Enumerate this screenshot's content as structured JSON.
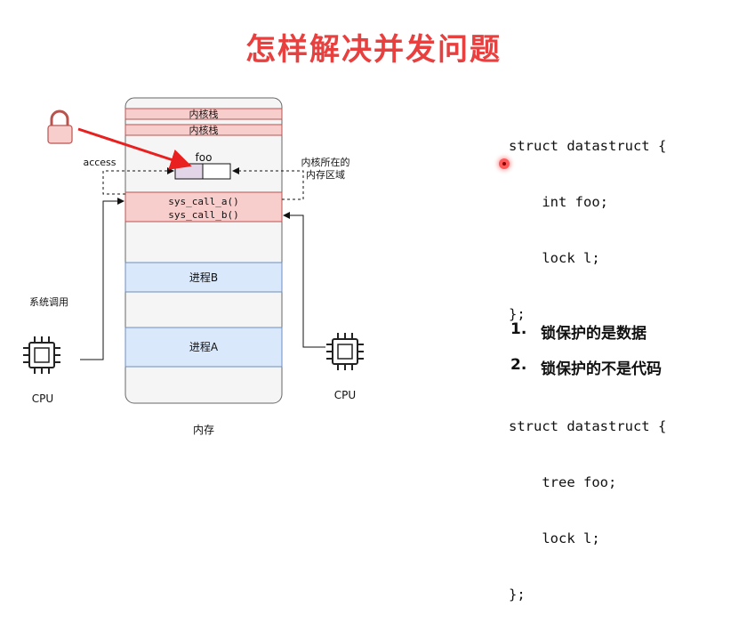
{
  "slide": {
    "title": "怎样解决并发问题"
  },
  "diagram": {
    "memory_label": "内存",
    "kernel_stack_1": "内核栈",
    "kernel_stack_2": "内核栈",
    "foo_label": "foo",
    "access_label": "access",
    "kernel_region_line1": "内核所在的",
    "kernel_region_line2": "内存区域",
    "syscall_a": "sys_call_a()",
    "syscall_b": "sys_call_b()",
    "process_b": "进程B",
    "process_a": "进程A",
    "syscall_caption": "系统调用",
    "cpu_left": "CPU",
    "cpu_right": "CPU"
  },
  "code": {
    "lines": [
      "struct datastruct {",
      "    int foo;",
      "    lock l;",
      "};",
      "",
      "struct datastruct {",
      "    tree foo;",
      "    lock l;",
      "};"
    ]
  },
  "points": [
    {
      "num": "1.",
      "text": "锁保护的是数据"
    },
    {
      "num": "2.",
      "text": "锁保护的不是代码"
    }
  ],
  "colors": {
    "title": "#e8403f",
    "kernel_stack_fill": "#f8cecc",
    "kernel_stack_stroke": "#b85450",
    "process_fill": "#dae8fc",
    "process_stroke": "#6c8ebf",
    "lock_fill": "#f8cecc",
    "arrow_red": "#e8201f",
    "foo_left_fill": "#e1d5e7",
    "memory_fill": "#f5f5f5"
  }
}
